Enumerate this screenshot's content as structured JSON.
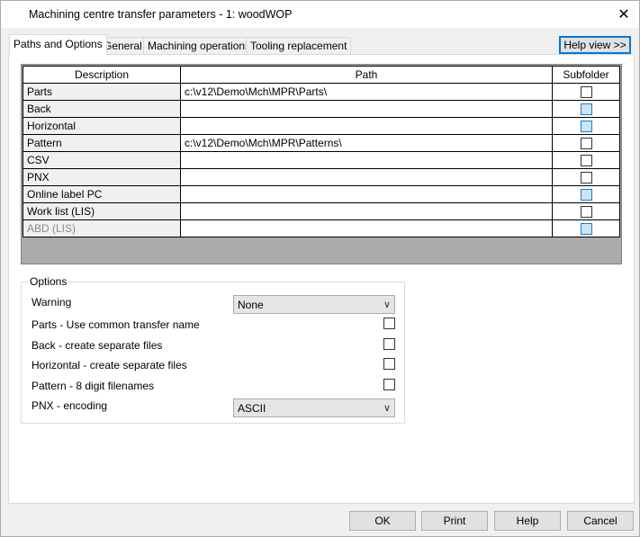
{
  "window": {
    "title": "Machining centre transfer parameters - 1: woodWOP",
    "close_glyph": "✕"
  },
  "tabs": [
    {
      "label": "Paths and Options",
      "active": true
    },
    {
      "label": "General",
      "active": false
    },
    {
      "label": "Machining operations",
      "active": false
    },
    {
      "label": "Tooling replacement",
      "active": false
    }
  ],
  "help_view_label": "Help view >>",
  "grid": {
    "headers": {
      "description": "Description",
      "path": "Path",
      "subfolder": "Subfolder"
    },
    "rows": [
      {
        "description": "Parts",
        "path": "c:\\v12\\Demo\\Mch\\MPR\\Parts\\",
        "subfolder_enabled": true,
        "desc_enabled": true
      },
      {
        "description": "Back",
        "path": "",
        "subfolder_enabled": false,
        "desc_enabled": true
      },
      {
        "description": "Horizontal",
        "path": "",
        "subfolder_enabled": false,
        "desc_enabled": true
      },
      {
        "description": "Pattern",
        "path": "c:\\v12\\Demo\\Mch\\MPR\\Patterns\\",
        "subfolder_enabled": true,
        "desc_enabled": true
      },
      {
        "description": "CSV",
        "path": "",
        "subfolder_enabled": true,
        "desc_enabled": true
      },
      {
        "description": "PNX",
        "path": "",
        "subfolder_enabled": true,
        "desc_enabled": true
      },
      {
        "description": "Online label PC",
        "path": "",
        "subfolder_enabled": false,
        "desc_enabled": true
      },
      {
        "description": "Work list (LIS)",
        "path": "",
        "subfolder_enabled": true,
        "desc_enabled": true
      },
      {
        "description": "ABD (LIS)",
        "path": "",
        "subfolder_enabled": false,
        "desc_enabled": false
      }
    ]
  },
  "options": {
    "title": "Options",
    "warning_label": "Warning",
    "warning_value": "None",
    "parts_common_label": "Parts - Use common transfer name",
    "back_separate_label": "Back - create separate files",
    "horizontal_separate_label": "Horizontal - create separate files",
    "pattern_8digit_label": "Pattern - 8 digit filenames",
    "pnx_encoding_label": "PNX - encoding",
    "pnx_encoding_value": "ASCII"
  },
  "buttons": {
    "ok": "OK",
    "print": "Print",
    "help": "Help",
    "cancel": "Cancel"
  }
}
